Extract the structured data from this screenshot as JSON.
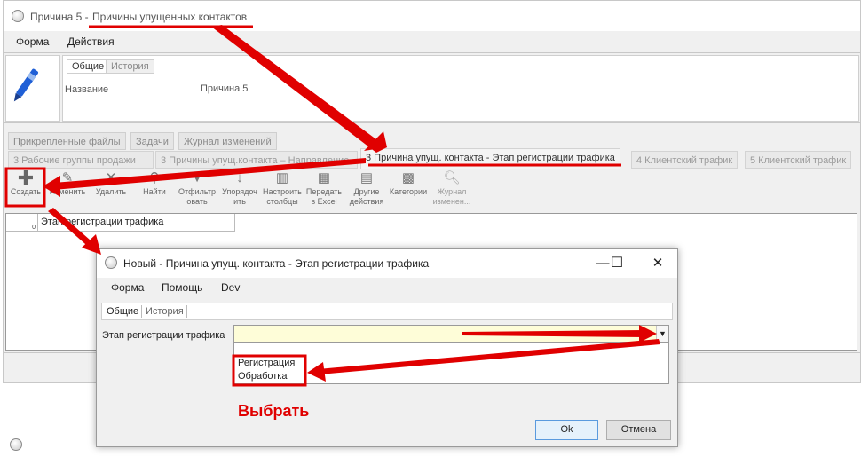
{
  "main_window": {
    "title_prefix": "Причина 5 - ",
    "title_highlight": "Причины упущенных контактов",
    "menu": [
      "Форма",
      "Действия"
    ],
    "header_tabs": [
      "Общие",
      "История"
    ],
    "name_label": "Название",
    "name_value": "Причина 5",
    "lower_tabs_row1": [
      "Прикрепленные файлы",
      "Задачи",
      "Журнал изменений"
    ],
    "lower_tabs_row2": [
      "3 Рабочие группы продажи",
      "3 Причины упущ.контакта – Направление",
      "3 Причина упущ. контакта - Этап регистрации трафика",
      "4 Клиентский трафик",
      "5 Клиентский трафик"
    ],
    "toolbar": [
      {
        "label": "Создать",
        "icon": "plus-icon"
      },
      {
        "label": "Изменить",
        "icon": "pencil-icon"
      },
      {
        "label": "Удалить",
        "icon": "delete-icon"
      },
      {
        "label": "Найти",
        "icon": "binoculars-icon"
      },
      {
        "label": "Отфильтр овать",
        "icon": "filter-icon"
      },
      {
        "label": "Упорядоч ить",
        "icon": "sort-icon"
      },
      {
        "label": "Настроить столбцы",
        "icon": "columns-icon"
      },
      {
        "label": "Передать в Excel",
        "icon": "excel-icon"
      },
      {
        "label": "Другие действия",
        "icon": "more-actions-icon"
      },
      {
        "label": "Категории",
        "icon": "categories-icon"
      },
      {
        "label": "Журнал изменен...",
        "icon": "log-icon"
      }
    ],
    "grid": {
      "row_count": "0",
      "column_header": "Этап регистрации трафика"
    }
  },
  "dialog": {
    "title": "Новый - Причина упущ. контакта - Этап регистрации трафика",
    "controls": {
      "minimize": "—",
      "maximize": "☐",
      "close": "✕"
    },
    "menu": [
      "Форма",
      "Помощь",
      "Dev"
    ],
    "tabs": [
      "Общие",
      "История"
    ],
    "field_label": "Этап регистрации трафика",
    "field_value": "",
    "dropdown_options": [
      "Регистрация",
      "Обработка"
    ],
    "annotation_text": "Выбрать",
    "ok_label": "Ok",
    "cancel_label": "Отмена"
  },
  "colors": {
    "annotation_red": "#e00000",
    "input_background": "#fefdd8",
    "window_background": "#f0f0f0"
  }
}
